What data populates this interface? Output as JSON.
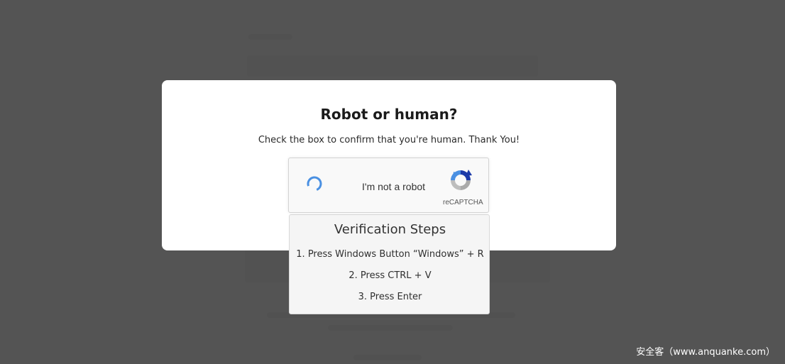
{
  "modal": {
    "title": "Robot or human?",
    "subtitle": "Check the box to confirm that you're human. Thank You!"
  },
  "recaptcha": {
    "label": "I'm not a robot",
    "brand": "reCAPTCHA",
    "spinner_icon": "loading-spinner-icon",
    "logo_icon": "recaptcha-logo-icon",
    "spinner_color": "#4a90e2"
  },
  "steps": {
    "title": "Verification Steps",
    "items": [
      "1. Press Windows Button “Windows” + R",
      "2. Press CTRL + V",
      "3. Press Enter"
    ]
  },
  "watermark": {
    "text": "安全客（www.anquanke.com）"
  },
  "colors": {
    "overlay": "#464646",
    "modal_bg": "#ffffff",
    "recaptcha_blue": "#1c3aa9",
    "recaptcha_light_blue": "#4a90e2",
    "recaptcha_gray": "#aaaaaa"
  }
}
